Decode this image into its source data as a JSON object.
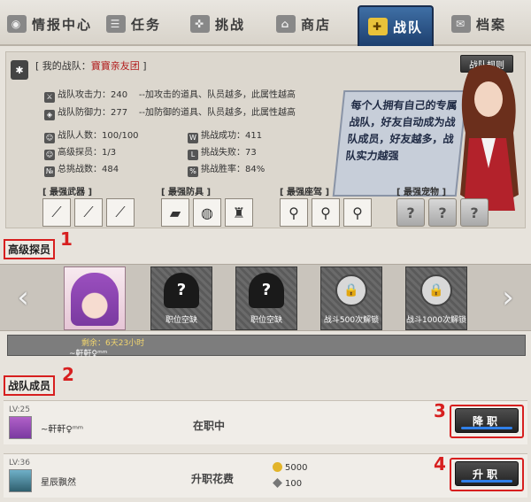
{
  "tabs": [
    {
      "label": "情报中心",
      "icon": "info-center-icon"
    },
    {
      "label": "任务",
      "icon": "mission-icon"
    },
    {
      "label": "挑战",
      "icon": "gun-icon"
    },
    {
      "label": "商店",
      "icon": "shop-icon"
    },
    {
      "label": "战队",
      "icon": "medal-icon",
      "active": true
    },
    {
      "label": "档案",
      "icon": "archive-icon"
    }
  ],
  "team": {
    "title_prefix": "[ 我的战队：",
    "name": "寶寶亲友团",
    "title_suffix": "]",
    "rules_button": "战队规则",
    "stats_left": [
      {
        "label": "战队攻击力：",
        "value": "240",
        "note": "--加攻击的道具、队员越多，此属性越高"
      },
      {
        "label": "战队防御力：",
        "value": "277",
        "note": "--加防御的道具、队员越多，此属性越高"
      }
    ],
    "stats_grid": [
      {
        "label": "战队人数：",
        "value": "100/100"
      },
      {
        "label": "挑战成功：",
        "value": "411"
      },
      {
        "label": "高级探员：",
        "value": "1/3"
      },
      {
        "label": "挑战失败：",
        "value": "73"
      },
      {
        "label": "总挑战数：",
        "value": "484"
      },
      {
        "label": "挑战胜率：",
        "value": "84%"
      }
    ],
    "banner_text": "每个人拥有自己的专属战队，好友自动成为战队成员，好友越多，战队实力越强",
    "categories": [
      "[ 最强武器 ]",
      "[ 最强防具 ]",
      "[ 最强座驾 ]",
      "[ 最强宠物 ]"
    ],
    "slots": {
      "weapons": [
        "blade-icon",
        "rifle-icon",
        "staff-icon"
      ],
      "armor": [
        "vest-icon",
        "drone-icon",
        "robot-icon"
      ],
      "vehicles": [
        "motorcycle-icon",
        "motorcycle-icon",
        "motorcycle-icon"
      ],
      "pets": [
        "?",
        "?",
        "?"
      ]
    }
  },
  "senior": {
    "label": "高级探员",
    "marker": "1",
    "cards": [
      {
        "type": "avatar",
        "label": ""
      },
      {
        "type": "vacant",
        "label": "职位空缺"
      },
      {
        "type": "vacant",
        "label": "职位空缺"
      },
      {
        "type": "locked",
        "label": "战斗500次解锁"
      },
      {
        "type": "locked",
        "label": "战斗1000次解锁"
      }
    ],
    "remaining": "剩余：6天23小时",
    "member_name": "~軒軒♀ᵐᵐ"
  },
  "members": {
    "label": "战队成员",
    "marker": "2",
    "rows": [
      {
        "level": "LV:25",
        "name": "~軒軒♀ᵐᵐ",
        "status": "在职中",
        "button": "降职",
        "marker": "3"
      },
      {
        "level": "LV:36",
        "name": "星辰飘然",
        "status": "升职花费",
        "button": "升职",
        "marker": "4",
        "cost_gold": "5000",
        "cost_item": "100"
      }
    ]
  },
  "colors": {
    "accent_red": "#d71f1f",
    "tab_active": "#2a5590",
    "button_bar": "#2f7fe8"
  }
}
